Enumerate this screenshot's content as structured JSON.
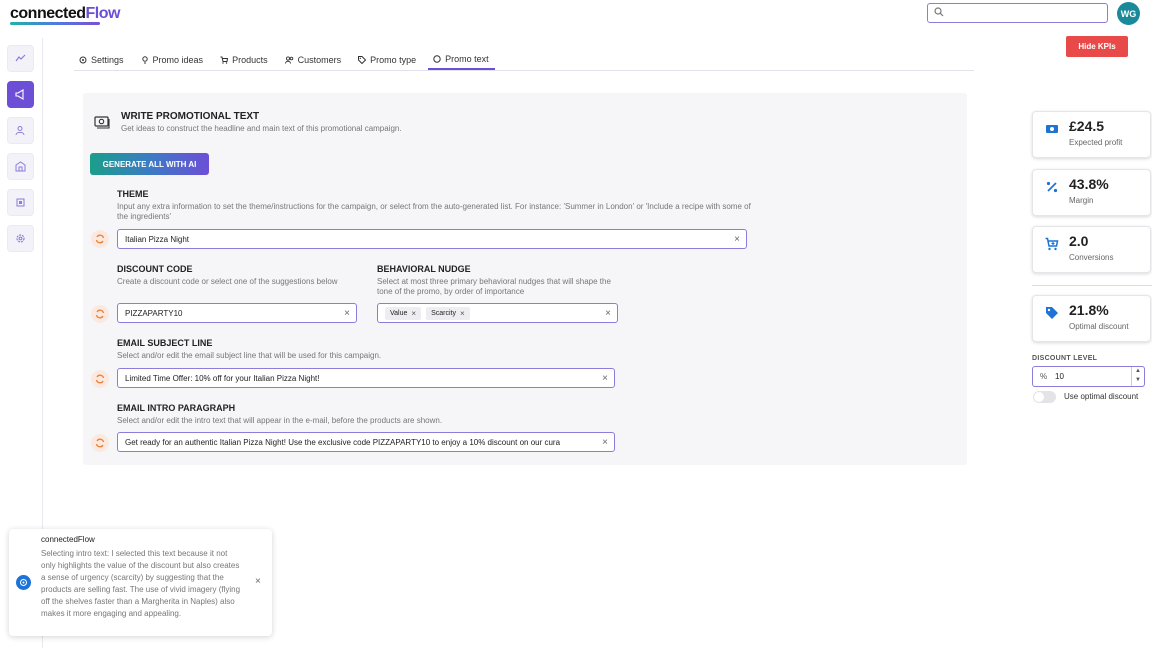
{
  "app": {
    "logo_part1": "connected",
    "logo_part2": "Flow",
    "search_placeholder": "",
    "user_initials": "WG"
  },
  "tabs": [
    {
      "label": "Settings",
      "icon": "gear-icon"
    },
    {
      "label": "Promo ideas",
      "icon": "lightbulb-icon"
    },
    {
      "label": "Products",
      "icon": "cart-icon"
    },
    {
      "label": "Customers",
      "icon": "users-icon"
    },
    {
      "label": "Promo type",
      "icon": "tag-icon"
    },
    {
      "label": "Promo text",
      "icon": "chat-icon",
      "active": true
    }
  ],
  "hide_kpis_label": "Hide KPIs",
  "section": {
    "title": "WRITE PROMOTIONAL TEXT",
    "subtitle": "Get ideas to construct the headline and main text of this promotional campaign.",
    "generate_label": "GENERATE ALL WITH AI"
  },
  "theme": {
    "label": "THEME",
    "help": "Input any extra information to set the theme/instructions for the campaign, or select from the auto-generated list. For instance: 'Summer in London' or 'Include a recipe with some of the ingredients'",
    "value": "Italian Pizza Night"
  },
  "discount_code": {
    "label": "DISCOUNT CODE",
    "help": "Create a discount code or select one of the suggestions below",
    "value": "PIZZAPARTY10"
  },
  "behavioral_nudge": {
    "label": "BEHAVIORAL NUDGE",
    "help": "Select at most three primary behavioral nudges that will shape the tone of the promo, by order of importance",
    "chips": [
      "Value",
      "Scarcity"
    ]
  },
  "email_subject": {
    "label": "EMAIL SUBJECT LINE",
    "help": "Select and/or edit the email subject line that will be used for this campaign.",
    "value": "Limited Time Offer: 10% off for your Italian Pizza Night!"
  },
  "email_intro": {
    "label": "EMAIL INTRO PARAGRAPH",
    "help": "Select and/or edit the intro text that will appear in the e-mail, before the products are shown.",
    "value": "Get ready for an authentic Italian Pizza Night! Use the exclusive code PIZZAPARTY10 to enjoy a 10% discount on our cura"
  },
  "kpis": [
    {
      "value": "£24.5",
      "label": "Expected profit",
      "icon": "money-icon"
    },
    {
      "value": "43.8%",
      "label": "Margin",
      "icon": "percent-icon"
    },
    {
      "value": "2.0",
      "label": "Conversions",
      "icon": "cart-plus-icon"
    },
    {
      "value": "21.8%",
      "label": "Optimal discount",
      "icon": "tag-icon"
    }
  ],
  "discount_level": {
    "label": "DISCOUNT LEVEL",
    "unit": "%",
    "value": "10",
    "toggle_label": "Use optimal discount",
    "toggle_on": false
  },
  "notification": {
    "title": "connectedFlow",
    "body": "Selecting intro text: I selected this text because it not only highlights the value of the discount but also creates a sense of urgency (scarcity) by suggesting that the products are selling fast. The use of vivid imagery (flying off the shelves faster than a Margherita in Naples) also makes it more engaging and appealing."
  },
  "colors": {
    "accent": "#6c4fd6",
    "danger": "#e84a4a",
    "kpi_icon": "#1d73d6",
    "refresh_icon": "#e8823a"
  }
}
